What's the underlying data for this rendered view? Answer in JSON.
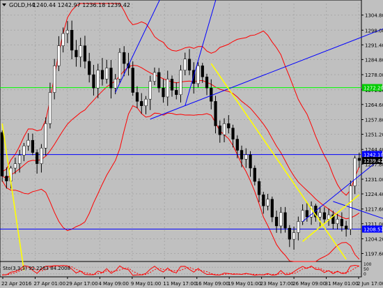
{
  "header": {
    "symbol": "GOLD,H4",
    "ohlc": "1240.44 1242.97 1236.18 1239.42"
  },
  "colors": {
    "background": "#c0c0c0",
    "bull_candle": "#ffffff",
    "bear_candle": "#000000",
    "candle_wick": "#000000",
    "bollinger": "#ff0000",
    "trendline_blue": "#0000ff",
    "trendline_yellow": "#ffff00",
    "level_green": "#00ff00",
    "level_blue": "#0000ff",
    "current_price_label_bg": "#000000",
    "green_label_bg": "#00cc00",
    "blue_label_bg": "#0000ff"
  },
  "chart_data": {
    "type": "candlestick",
    "title": "GOLD,H4",
    "ylim": [
      1194.0,
      1310.0
    ],
    "y_ticks": [
      "1304.80",
      "1298.00",
      "1291.40",
      "1284.80",
      "1278.00",
      "1271.20",
      "1264.60",
      "1257.80",
      "1251.20",
      "1244.40",
      "1237.80",
      "1231.00",
      "1224.40",
      "1217.60",
      "1211.00",
      "1204.20",
      "1197.60"
    ],
    "x_ticks": [
      "22 Apr 2016",
      "27 Apr 01:00",
      "29 Apr 17:00",
      "4 May 09:00",
      "9 May 01:00",
      "11 May 17:00",
      "16 May 09:00",
      "19 May 01:00",
      "23 May 17:00",
      "26 May 09:00",
      "31 May 01:00",
      "2 Jun 17:00"
    ],
    "price_labels": [
      {
        "value": "1272.20",
        "style": "green"
      },
      {
        "value": "1242.10",
        "style": "blue"
      },
      {
        "value": "1239.42",
        "style": "current"
      },
      {
        "value": "1208.57",
        "style": "blue"
      }
    ],
    "horizontal_levels": [
      {
        "price": 1272.2,
        "color": "green"
      },
      {
        "price": 1242.1,
        "color": "blue"
      },
      {
        "price": 1208.57,
        "color": "blue"
      }
    ],
    "trendlines": [
      {
        "color": "blue",
        "from": [
          26.0,
          1270.0
        ],
        "to": [
          37.0,
          1315.0
        ]
      },
      {
        "color": "blue",
        "from": [
          34.0,
          1258.0
        ],
        "to": [
          88.0,
          1299.0
        ]
      },
      {
        "color": "blue",
        "from": [
          42.0,
          1264.0
        ],
        "to": [
          50.0,
          1318.0
        ]
      },
      {
        "color": "blue",
        "from": [
          69.0,
          1212.0
        ],
        "to": [
          88.0,
          1242.0
        ]
      },
      {
        "color": "blue",
        "from": [
          76.0,
          1221.0
        ],
        "to": [
          88.0,
          1213.0
        ]
      },
      {
        "color": "yellow",
        "from": [
          0.0,
          1256.0
        ],
        "to": [
          5.0,
          1190.0
        ]
      },
      {
        "color": "yellow",
        "from": [
          48.0,
          1283.0
        ],
        "to": [
          79.0,
          1195.0
        ]
      },
      {
        "color": "yellow",
        "from": [
          69.0,
          1203.0
        ],
        "to": [
          82.0,
          1224.0
        ]
      }
    ],
    "candles": [
      [
        1252.0,
        1252.9,
        1229.9,
        1232.4
      ],
      [
        1232.4,
        1236.3,
        1226.8,
        1230.2
      ],
      [
        1230.2,
        1237.0,
        1226.8,
        1236.0
      ],
      [
        1236.0,
        1240.7,
        1233.4,
        1238.0
      ],
      [
        1238.0,
        1244.2,
        1234.0,
        1241.8
      ],
      [
        1241.8,
        1247.3,
        1239.1,
        1246.0
      ],
      [
        1246.0,
        1251.7,
        1243.8,
        1248.5
      ],
      [
        1248.5,
        1251.5,
        1241.8,
        1243.0
      ],
      [
        1243.0,
        1244.4,
        1233.5,
        1238.0
      ],
      [
        1238.0,
        1246.8,
        1234.0,
        1245.0
      ],
      [
        1245.0,
        1258.8,
        1241.6,
        1256.0
      ],
      [
        1256.0,
        1274.4,
        1253.8,
        1270.0
      ],
      [
        1270.0,
        1285.1,
        1266.9,
        1282.0
      ],
      [
        1282.0,
        1295.3,
        1279.6,
        1291.0
      ],
      [
        1291.0,
        1299.2,
        1288.0,
        1296.5
      ],
      [
        1296.5,
        1302.1,
        1292.2,
        1298.0
      ],
      [
        1298.0,
        1302.3,
        1284.9,
        1289.0
      ],
      [
        1289.0,
        1293.6,
        1281.6,
        1286.0
      ],
      [
        1286.0,
        1294.6,
        1281.4,
        1291.0
      ],
      [
        1291.0,
        1295.5,
        1280.8,
        1284.0
      ],
      [
        1284.0,
        1287.8,
        1274.5,
        1278.0
      ],
      [
        1278.0,
        1282.4,
        1268.6,
        1272.0
      ],
      [
        1272.0,
        1282.9,
        1267.4,
        1280.0
      ],
      [
        1280.0,
        1285.5,
        1273.1,
        1276.0
      ],
      [
        1276.0,
        1284.7,
        1274.0,
        1281.0
      ],
      [
        1281.0,
        1284.6,
        1267.3,
        1272.0
      ],
      [
        1272.0,
        1278.3,
        1269.2,
        1276.0
      ],
      [
        1276.0,
        1289.9,
        1274.3,
        1288.0
      ],
      [
        1288.0,
        1290.8,
        1277.3,
        1283.0
      ],
      [
        1283.0,
        1287.8,
        1277.6,
        1281.0
      ],
      [
        1281.0,
        1284.0,
        1268.5,
        1270.0
      ],
      [
        1270.0,
        1272.8,
        1262.9,
        1266.0
      ],
      [
        1266.0,
        1269.7,
        1260.4,
        1264.0
      ],
      [
        1264.0,
        1268.4,
        1260.2,
        1267.0
      ],
      [
        1267.0,
        1277.5,
        1262.1,
        1275.0
      ],
      [
        1275.0,
        1281.2,
        1273.3,
        1279.0
      ],
      [
        1279.0,
        1281.0,
        1270.0,
        1272.0
      ],
      [
        1272.0,
        1276.0,
        1265.4,
        1268.0
      ],
      [
        1268.0,
        1279.8,
        1264.0,
        1276.0
      ],
      [
        1276.0,
        1277.6,
        1268.1,
        1271.0
      ],
      [
        1271.0,
        1274.6,
        1266.9,
        1269.0
      ],
      [
        1269.0,
        1282.3,
        1265.5,
        1280.0
      ],
      [
        1280.0,
        1287.9,
        1277.7,
        1285.0
      ],
      [
        1285.0,
        1289.5,
        1277.8,
        1280.0
      ],
      [
        1280.0,
        1283.6,
        1269.5,
        1274.0
      ],
      [
        1274.0,
        1283.7,
        1272.3,
        1282.0
      ],
      [
        1282.0,
        1283.3,
        1274.3,
        1277.0
      ],
      [
        1277.0,
        1278.4,
        1268.8,
        1272.0
      ],
      [
        1272.0,
        1275.9,
        1262.4,
        1266.0
      ],
      [
        1266.0,
        1268.5,
        1251.6,
        1255.0
      ],
      [
        1255.0,
        1257.4,
        1247.4,
        1251.0
      ],
      [
        1251.0,
        1258.4,
        1247.6,
        1256.0
      ],
      [
        1256.0,
        1259.8,
        1251.6,
        1254.0
      ],
      [
        1254.0,
        1255.5,
        1245.3,
        1249.0
      ],
      [
        1249.0,
        1250.7,
        1240.4,
        1244.0
      ],
      [
        1244.0,
        1246.1,
        1236.4,
        1240.0
      ],
      [
        1240.0,
        1244.9,
        1236.1,
        1242.0
      ],
      [
        1242.0,
        1243.6,
        1232.1,
        1236.0
      ],
      [
        1236.0,
        1237.2,
        1228.2,
        1230.0
      ],
      [
        1230.0,
        1231.4,
        1220.7,
        1224.0
      ],
      [
        1224.0,
        1225.3,
        1215.5,
        1219.0
      ],
      [
        1219.0,
        1224.4,
        1217.0,
        1222.0
      ],
      [
        1222.0,
        1223.2,
        1211.7,
        1214.0
      ],
      [
        1214.0,
        1216.9,
        1206.9,
        1210.0
      ],
      [
        1210.0,
        1218.5,
        1206.7,
        1216.0
      ],
      [
        1216.0,
        1218.5,
        1207.0,
        1209.0
      ],
      [
        1209.0,
        1210.4,
        1200.5,
        1204.0
      ],
      [
        1204.0,
        1209.7,
        1199.3,
        1207.0
      ],
      [
        1207.0,
        1214.2,
        1203.5,
        1212.0
      ],
      [
        1212.0,
        1219.7,
        1210.4,
        1217.0
      ],
      [
        1217.0,
        1220.8,
        1211.9,
        1214.0
      ],
      [
        1214.0,
        1221.0,
        1210.5,
        1219.0
      ],
      [
        1219.0,
        1220.0,
        1211.9,
        1214.0
      ],
      [
        1214.0,
        1218.6,
        1209.1,
        1216.0
      ],
      [
        1216.0,
        1218.4,
        1210.9,
        1213.0
      ],
      [
        1213.0,
        1217.8,
        1210.0,
        1215.0
      ],
      [
        1215.0,
        1216.8,
        1208.5,
        1211.0
      ],
      [
        1211.0,
        1215.4,
        1208.4,
        1213.0
      ],
      [
        1213.0,
        1216.1,
        1207.5,
        1210.0
      ],
      [
        1210.0,
        1212.3,
        1205.2,
        1208.5
      ],
      [
        1208.5,
        1230.4,
        1205.9,
        1228.0
      ],
      [
        1228.0,
        1241.6,
        1224.3,
        1240.44
      ],
      [
        1240.44,
        1242.97,
        1236.18,
        1239.42
      ]
    ],
    "indicator": {
      "label": "Sto(3,3,3) 92.2263 84.2008",
      "ylim": [
        0,
        100
      ],
      "levels": [
        80,
        20
      ],
      "axis_labels": [
        "100",
        "50",
        "0"
      ]
    }
  }
}
